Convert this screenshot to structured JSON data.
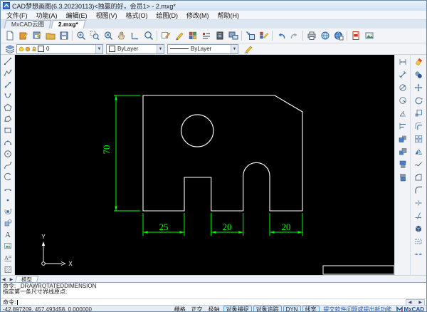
{
  "title_bar": {
    "title": "CAD梦想画图(6.3.20230113)<独赢的好，会员1> - 2.mxg*"
  },
  "menu_bar": {
    "items": [
      "文件(F)",
      "功能(A)",
      "编辑(E)",
      "视图(V)",
      "格式(O)",
      "绘图(D)",
      "修改(M)",
      "帮助(H)"
    ]
  },
  "tab_bar": {
    "tabs": [
      "MxCAD云图",
      "2.mxg*"
    ]
  },
  "toolbar_main": {
    "icons": [
      "new-file",
      "open-drawing",
      "save-drawing",
      "open-folder",
      "save-as",
      "zoom-in",
      "zoom-window",
      "zoom-extents",
      "pan",
      "axis-measure",
      "zoom-all",
      "annotate",
      "edit-pencil",
      "color-palette",
      "text-style",
      "layer-manager",
      "save-view",
      "insert-block",
      "match-properties",
      "undo",
      "redo",
      "print",
      "web-cloud",
      "web-publish",
      "export-pdf",
      "export-image"
    ]
  },
  "toolbar_format": {
    "layer_value": "0",
    "color_value": "ByLayer",
    "linetype_value": "ByLayer"
  },
  "left_toolbar": {
    "icons": [
      "line",
      "polyline",
      "construction-line",
      "arc",
      "polygon",
      "closed-polyline",
      "rectangle",
      "arc-3point",
      "circle",
      "spline",
      "ellipse",
      "arc-segment",
      "point",
      "insert-block",
      "make-block",
      "text",
      "image",
      "mtext",
      "hatch"
    ]
  },
  "dimension_toolbar": {
    "icons": [
      "linear-dimension",
      "aligned-dimension",
      "diameter-dimension",
      "radius-dimension",
      "angular-dimension",
      "baseline-dimension",
      "draw-order-front",
      "draw-order-back",
      "draw-order-above",
      "draw-order-below"
    ]
  },
  "modify_toolbar": {
    "icons": [
      "erase",
      "copy",
      "move",
      "rotate",
      "scale",
      "offset",
      "array",
      "mirror",
      "spline-edit",
      "chamfer",
      "fillet",
      "break",
      "trim",
      "explode",
      "region",
      "join"
    ]
  },
  "canvas": {
    "colors": {
      "background": "#000000",
      "geometry": "#ffffff",
      "dimension": "#00ff00"
    },
    "dimension_values": {
      "height": 70,
      "bottom_widths": [
        25,
        20,
        20
      ]
    },
    "dim_height": "70",
    "dim_w1": "25",
    "dim_w2": "20",
    "dim_w3": "20",
    "ucs_x": "X",
    "ucs_y": "Y"
  },
  "model_strip": {
    "tab": "模型"
  },
  "command_panel": {
    "history": [
      "命令: _DRAWROTATEDDIMENSION",
      "",
      "指定第一条尺寸界线原点:"
    ],
    "prompt": "命令:"
  },
  "status_bar": {
    "coordinates": "-42.897209, 457.493458, 0.000000",
    "toggles": [
      {
        "label": "栅格",
        "active": false
      },
      {
        "label": "正交",
        "active": false
      },
      {
        "label": "极轴",
        "active": false
      },
      {
        "label": "对象捕捉",
        "active": true
      },
      {
        "label": "对象追踪",
        "active": true
      },
      {
        "label": "DYN",
        "active": true
      },
      {
        "label": "线宽",
        "active": true
      }
    ],
    "feedback_link": "提交软件问题或提出新功能",
    "brand": "MxCAD"
  }
}
